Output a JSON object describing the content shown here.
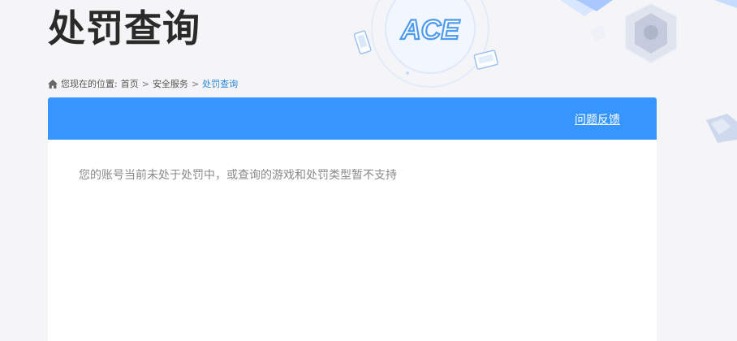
{
  "page": {
    "title": "处罚查询",
    "logo_text": "ACE"
  },
  "breadcrumb": {
    "prefix": "您现在的位置:",
    "items": [
      "首页",
      "安全服务"
    ],
    "separator": ">",
    "current": "处罚查询"
  },
  "panel": {
    "feedback_label": "问题反馈",
    "message": "您的账号当前未处于处罚中，或查询的游戏和处罚类型暂不支持"
  },
  "icons": {
    "home": "home-icon",
    "game_card": "game-card-icon",
    "phone_game": "phone-game-icon"
  },
  "colors": {
    "header_blue": "#3796fd",
    "link_blue": "#2a87d8",
    "title": "#2a2a2a",
    "message": "#8a8a8a",
    "page_bg": "#f5f5f7"
  }
}
